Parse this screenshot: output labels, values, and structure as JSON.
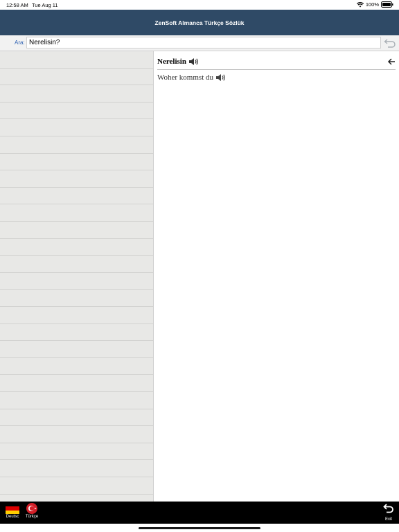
{
  "status": {
    "time": "12:58 AM",
    "date": "Tue Aug 11",
    "battery": "100%"
  },
  "app": {
    "title": "ZenSoft Almanca Türkçe Sözlük"
  },
  "search": {
    "label": "Ara:",
    "value": "Nerelisin?"
  },
  "detail": {
    "headword": "Nerelisin",
    "translation": "Woher kommst du"
  },
  "toolbar": {
    "lang_de": "Deutsc",
    "lang_tr": "Türkçe",
    "exit": "Exit"
  },
  "colors": {
    "title_bar": "#2f4a66",
    "list_bg": "#e8e8e6",
    "search_label": "#2f62b3",
    "toolbar_bg": "#000000"
  },
  "icons": [
    "wifi-icon",
    "battery-icon",
    "undo-icon",
    "speaker-icon",
    "back-arrow-icon",
    "german-flag-icon",
    "turkish-flag-icon",
    "exit-icon"
  ]
}
